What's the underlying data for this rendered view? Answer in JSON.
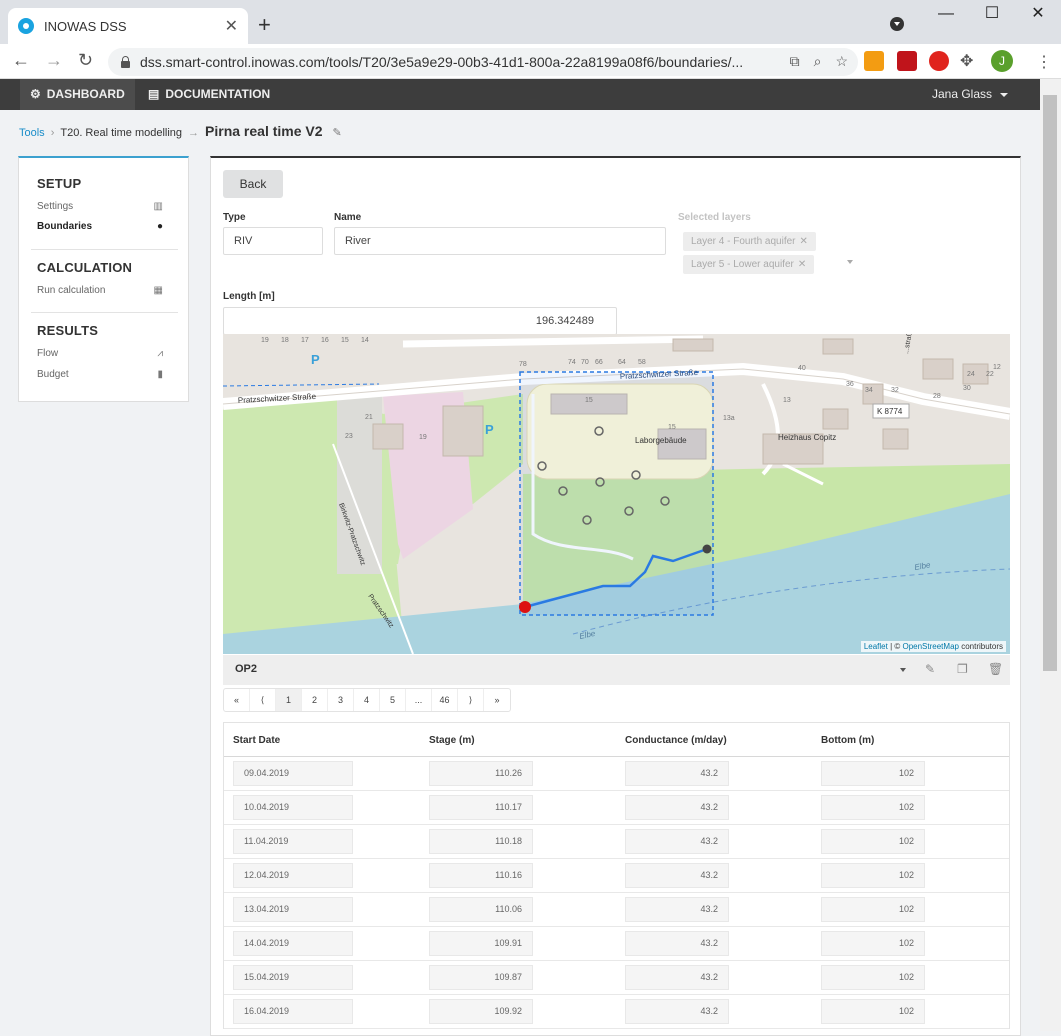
{
  "browser": {
    "tab_title": "INOWAS DSS",
    "url": "dss.smart-control.inowas.com/tools/T20/3e5a9e29-00b3-41d1-800a-22a8199a08f6/boundaries/...",
    "profile_initial": "J"
  },
  "appnav": {
    "dashboard": "DASHBOARD",
    "documentation": "DOCUMENTATION",
    "user": "Jana Glass"
  },
  "breadcrumb": {
    "tools": "Tools",
    "tool": "T20. Real time modelling",
    "title": "Pirna real time V2"
  },
  "sidebar": {
    "setup": "SETUP",
    "settings": "Settings",
    "boundaries": "Boundaries",
    "calculation": "CALCULATION",
    "run_calculation": "Run calculation",
    "results": "RESULTS",
    "flow": "Flow",
    "budget": "Budget"
  },
  "form": {
    "back": "Back",
    "type_label": "Type",
    "type_value": "RIV",
    "name_label": "Name",
    "name_value": "River",
    "layers_label": "Selected layers",
    "layers": [
      "Layer 4 - Fourth aquifer",
      "Layer 5 - Lower aquifer"
    ],
    "length_label": "Length [m]",
    "length_value": "196.342489"
  },
  "map": {
    "labels": {
      "street_1": "Pratzschwitzer Straße",
      "street_2": "Pratzschwitzer Straße",
      "street_3": "Birkwitz-Pratzschwitz",
      "street_4": "Pratzschwitz",
      "road_ref": "K 8774",
      "building_1": "Laborgebäude",
      "building_2": "Heizhaus\nCopitz",
      "river_1": "Elbe",
      "river_2": "Elbe",
      "street_5": "...straße"
    },
    "house_numbers": [
      "19",
      "18",
      "17",
      "16",
      "15",
      "14",
      "78",
      "74",
      "70",
      "66",
      "64",
      "58",
      "21",
      "23",
      "19",
      "15",
      "15",
      "13a",
      "13",
      "40",
      "36",
      "34",
      "32",
      "28",
      "30",
      "24",
      "22",
      "12"
    ],
    "attribution_leaflet": "Leaflet",
    "attribution_osm": "OpenStreetMap",
    "attribution_rest": " contributors",
    "attribution_sep": " | © "
  },
  "op": {
    "name": "OP2"
  },
  "pager": [
    "«",
    "⟨",
    "1",
    "2",
    "3",
    "4",
    "5",
    "...",
    "46",
    "⟩",
    "»"
  ],
  "pager_active": "1",
  "table": {
    "headers": [
      "Start Date",
      "Stage (m)",
      "Conductance (m/day)",
      "Bottom (m)"
    ],
    "rows": [
      [
        "09.04.2019",
        "110.26",
        "43.2",
        "102"
      ],
      [
        "10.04.2019",
        "110.17",
        "43.2",
        "102"
      ],
      [
        "11.04.2019",
        "110.18",
        "43.2",
        "102"
      ],
      [
        "12.04.2019",
        "110.16",
        "43.2",
        "102"
      ],
      [
        "13.04.2019",
        "110.06",
        "43.2",
        "102"
      ],
      [
        "14.04.2019",
        "109.91",
        "43.2",
        "102"
      ],
      [
        "15.04.2019",
        "109.87",
        "43.2",
        "102"
      ],
      [
        "16.04.2019",
        "109.92",
        "43.2",
        "102"
      ]
    ]
  },
  "colors": {
    "accent": "#1a8dc9",
    "header": "#3d3d3d",
    "river_line": "#2a7ae2",
    "start_marker": "#dd1111"
  }
}
